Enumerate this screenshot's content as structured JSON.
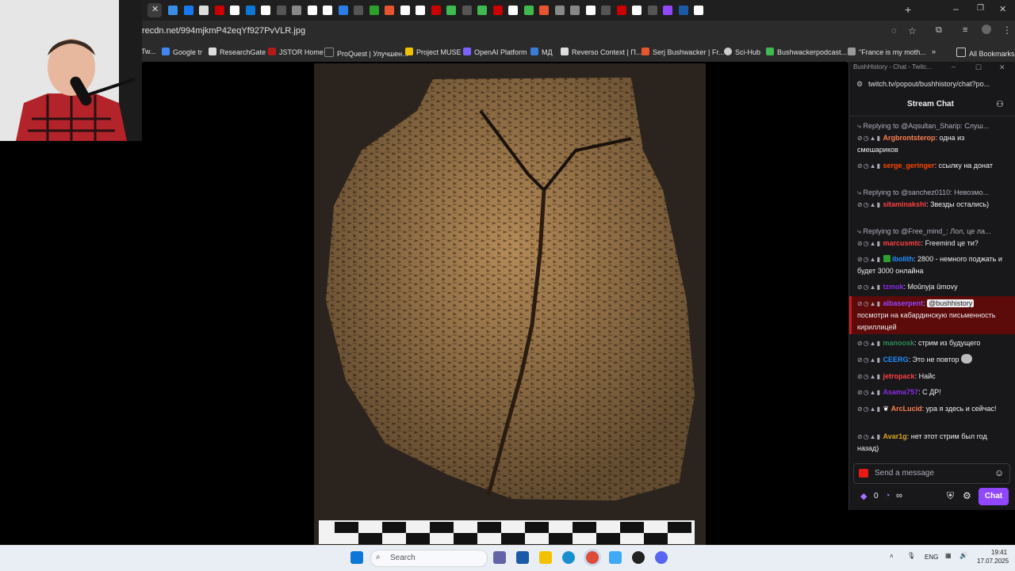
{
  "browser": {
    "url": "recdn.net/994mjkmP42eqYf927PvVLR.jpg",
    "bookmarks": [
      "Tw...",
      "Google tr",
      "ResearchGate",
      "JSTOR Home",
      "ProQuest | Улучшен...",
      "Project MUSE",
      "OpenAI Platform",
      "МД",
      "Reverso Context | П...",
      "Serj Bushwacker | Fr...",
      "Sci-Hub",
      "Bushwackerpodcast...",
      "\"France is my moth..."
    ],
    "all_bookmarks": "All Bookmarks",
    "colors": {
      "chrome_bg": "#1f1f1f",
      "toolbar_bg": "#2b2b2b"
    }
  },
  "chat_window": {
    "title": "BushHistory - Chat - Twitc...",
    "url": "twitch.tv/popout/bushhistory/chat?po...",
    "header": "Stream Chat",
    "messages": [
      {
        "reply": "Replying to @Aqsultan_Sharip: Слуш...",
        "user": "Argbrontsterop",
        "color": "#ff7f50",
        "text": ": одна из смешариков"
      },
      {
        "user": "serge_geringer",
        "color": "#ff4500",
        "text": ": ссылку на донат"
      },
      {
        "reply": "Replying to @sanchez0110: Невозмо...",
        "user": "sitaminakshi",
        "color": "#ff4040",
        "text": ": Звезды остались)"
      },
      {
        "reply": "Replying to @Free_mind_: Лол, це ла...",
        "user": "marcusmtc",
        "color": "#ff4040",
        "text": ": Freemind це ти?"
      },
      {
        "user": "ibolith",
        "color": "#1e90ff",
        "text": ": 2800 - немного поджать и будет 3000 онлайна"
      },
      {
        "user": "tzmok",
        "color": "#8a2be2",
        "text": ": Moûnуja ûmovy"
      },
      {
        "user": "albaserpent",
        "color": "#9146ff",
        "mention": "@bushhistory",
        "text": "посмотри на кабардинскую письменность кириллицей"
      },
      {
        "user": "manoosk",
        "color": "#2e8b57",
        "text": ": стрим из будущего"
      },
      {
        "user": "CEERG",
        "color": "#1e90ff",
        "text": ": Это не повтор"
      },
      {
        "user": "jetropack",
        "color": "#ff4040",
        "text": ": Найс"
      },
      {
        "user": "Asama757",
        "color": "#8a2be2",
        "text": ": С ДР!"
      },
      {
        "user": "ArcLucid",
        "color": "#ff7f50",
        "text": ": ура я здесь и сейчас!"
      },
      {
        "user": "Avar1g",
        "color": "#daa520",
        "text": ": нет этот стрим был год назад)"
      }
    ],
    "input_placeholder": "Send a message",
    "points": "0",
    "chat_button": "Chat",
    "infinity": "∞"
  },
  "taskbar": {
    "search_placeholder": "Search",
    "lang": "ENG",
    "time": "19:41",
    "date": "17.07.2025"
  }
}
